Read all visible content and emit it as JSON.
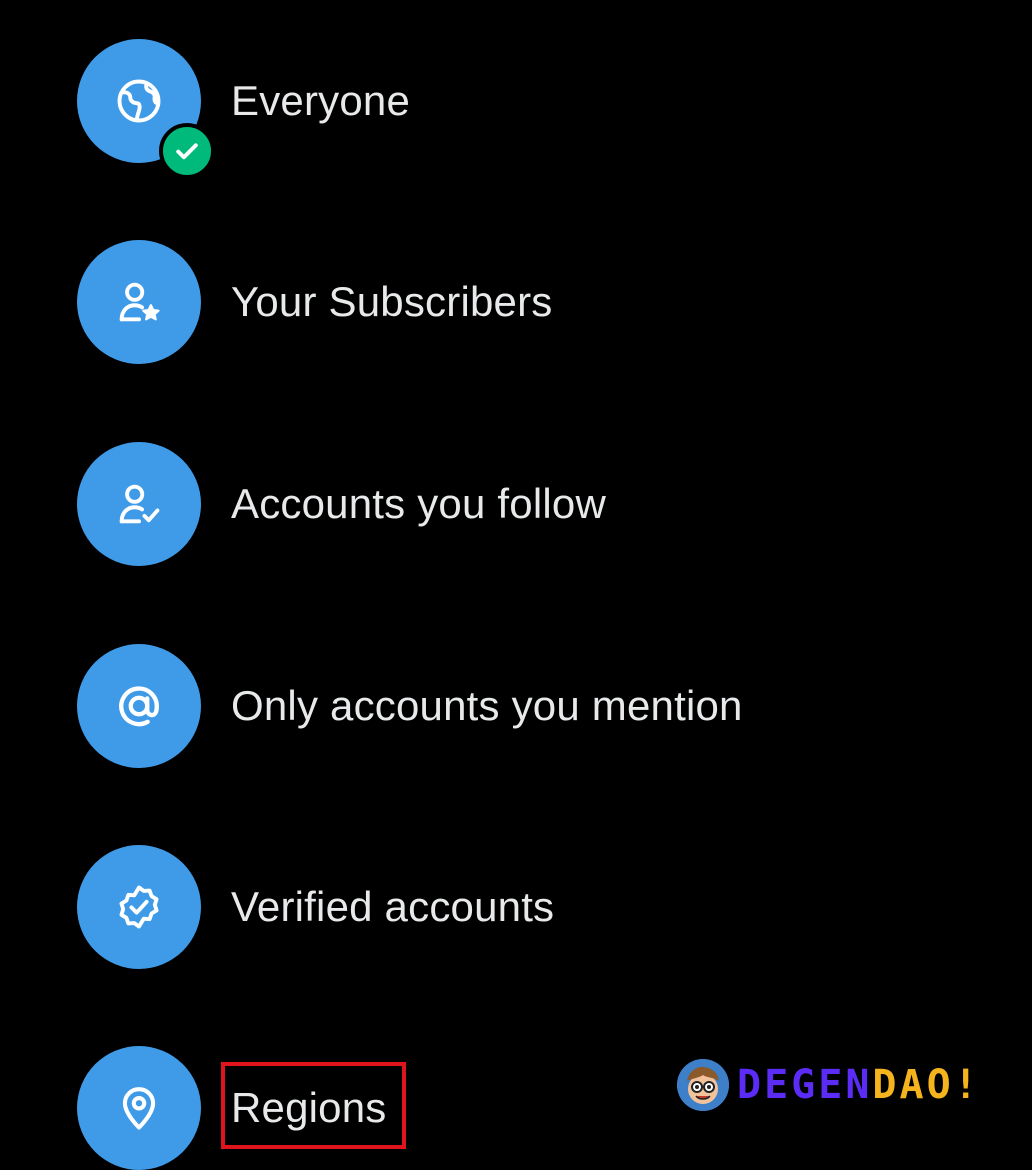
{
  "options": [
    {
      "label": "Everyone",
      "icon": "globe-icon",
      "selected": true
    },
    {
      "label": "Your Subscribers",
      "icon": "person-star-icon",
      "selected": false
    },
    {
      "label": "Accounts you follow",
      "icon": "person-check-icon",
      "selected": false
    },
    {
      "label": "Only accounts you mention",
      "icon": "at-sign-icon",
      "selected": false
    },
    {
      "label": "Verified accounts",
      "icon": "verified-badge-icon",
      "selected": false
    },
    {
      "label": "Regions",
      "icon": "location-pin-icon",
      "selected": false
    }
  ],
  "watermark": {
    "part1": "DEGEN",
    "part2": "DAO!"
  },
  "colors": {
    "background": "#000000",
    "icon_circle": "#3f9be8",
    "label_text": "#e7e9ea",
    "selected_badge": "#00ba7c",
    "highlight_box": "#e0141c",
    "watermark_part1": "#5b2cf5",
    "watermark_part2": "#f5b41e"
  }
}
